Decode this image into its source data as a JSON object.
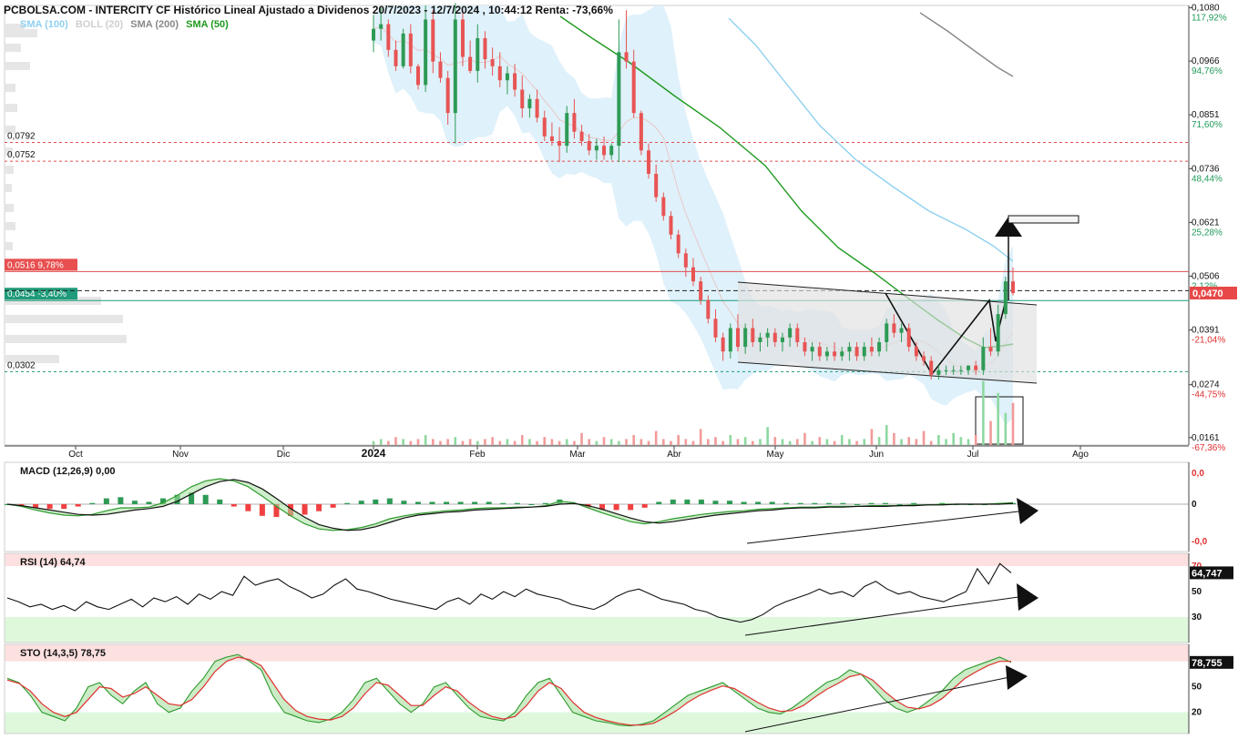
{
  "header": {
    "title": "PCBOLSA.COM - INTERCITY CF Histórico Lineal Ajustado a Dividenos 20/7/2023 - 12/7/2024 , 10:44:12 Renta: -73,66%",
    "legend": [
      {
        "label": "SMA (100)",
        "color": "#8fd0f0"
      },
      {
        "label": "BOLL (20)",
        "color": "#cfcfcf"
      },
      {
        "label": "SMA (200)",
        "color": "#888888"
      },
      {
        "label": "SMA (50)",
        "color": "#1f9a1f"
      }
    ]
  },
  "chart_data": [
    {
      "type": "candlestick",
      "panel": "price",
      "months": [
        "Oct",
        "Nov",
        "Dic",
        "2024",
        "Feb",
        "Mar",
        "Abr",
        "May",
        "Jun",
        "Jul",
        "Ago"
      ],
      "y_ticks": [
        {
          "price": "0,1080",
          "pct": "117,92%"
        },
        {
          "price": "0,0966",
          "pct": "94,76%"
        },
        {
          "price": "0,0851",
          "pct": "71,60%"
        },
        {
          "price": "0,0736",
          "pct": "48,44%"
        },
        {
          "price": "0,0621",
          "pct": "25,28%"
        },
        {
          "price": "0,0506",
          "pct": "2,12%"
        },
        {
          "price": "0,0391",
          "pct": "-21,04%"
        },
        {
          "price": "0,0274",
          "pct": "-44,75%"
        },
        {
          "price": "0,0161",
          "pct": "-67,36%"
        }
      ],
      "ylim": [
        0.0145,
        0.1085
      ],
      "last_price": "0,0470",
      "last_price_value": 0.047,
      "level_labels": [
        {
          "text": "0,0792",
          "value": 0.0792,
          "style": "red-dashed"
        },
        {
          "text": "0,0752",
          "value": 0.0752,
          "style": "red-dashed"
        },
        {
          "text": "0,0516  9,78%",
          "value": 0.0516,
          "style": "red-solid"
        },
        {
          "text": "0,0454  -3,40%",
          "value": 0.0454,
          "style": "green-solid"
        },
        {
          "text": "0,0302",
          "value": 0.0302,
          "style": "green-dashed"
        }
      ],
      "candles": [
        [
          0.101,
          0.1065,
          0.0985,
          0.1035
        ],
        [
          0.1035,
          0.108,
          0.101,
          0.1045
        ],
        [
          0.1045,
          0.1055,
          0.0975,
          0.099
        ],
        [
          0.099,
          0.101,
          0.0945,
          0.0955
        ],
        [
          0.0955,
          0.1035,
          0.095,
          0.1025
        ],
        [
          0.1025,
          0.1045,
          0.094,
          0.0955
        ],
        [
          0.0955,
          0.096,
          0.0905,
          0.0915
        ],
        [
          0.0915,
          0.1085,
          0.09,
          0.1055
        ],
        [
          0.1055,
          0.1075,
          0.094,
          0.0965
        ],
        [
          0.0965,
          0.0985,
          0.092,
          0.093
        ],
        [
          0.093,
          0.0945,
          0.083,
          0.0855
        ],
        [
          0.0855,
          0.109,
          0.079,
          0.1055
        ],
        [
          0.1055,
          0.1075,
          0.0955,
          0.0975
        ],
        [
          0.0975,
          0.101,
          0.094,
          0.0945
        ],
        [
          0.0945,
          0.1045,
          0.092,
          0.1015
        ],
        [
          0.1015,
          0.103,
          0.095,
          0.097
        ],
        [
          0.097,
          0.0995,
          0.0935,
          0.0955
        ],
        [
          0.0955,
          0.0985,
          0.091,
          0.0925
        ],
        [
          0.0925,
          0.0955,
          0.0895,
          0.094
        ],
        [
          0.094,
          0.096,
          0.089,
          0.0905
        ],
        [
          0.0905,
          0.0935,
          0.0845,
          0.0865
        ],
        [
          0.0865,
          0.0895,
          0.0845,
          0.0885
        ],
        [
          0.0885,
          0.0905,
          0.0835,
          0.0845
        ],
        [
          0.0845,
          0.086,
          0.0795,
          0.0805
        ],
        [
          0.0805,
          0.0835,
          0.0785,
          0.0795
        ],
        [
          0.0795,
          0.0825,
          0.075,
          0.0785
        ],
        [
          0.0785,
          0.087,
          0.077,
          0.0855
        ],
        [
          0.0855,
          0.0885,
          0.08,
          0.0815
        ],
        [
          0.0815,
          0.083,
          0.0785,
          0.0795
        ],
        [
          0.0795,
          0.081,
          0.0765,
          0.0775
        ],
        [
          0.0775,
          0.08,
          0.0755,
          0.0785
        ],
        [
          0.0785,
          0.0805,
          0.0755,
          0.0765
        ],
        [
          0.0765,
          0.079,
          0.0755,
          0.0785
        ],
        [
          0.0785,
          0.1055,
          0.075,
          0.0985
        ],
        [
          0.0985,
          0.1075,
          0.095,
          0.0965
        ],
        [
          0.0965,
          0.099,
          0.0845,
          0.0855
        ],
        [
          0.0855,
          0.086,
          0.0765,
          0.0775
        ],
        [
          0.0775,
          0.079,
          0.0715,
          0.0725
        ],
        [
          0.0725,
          0.0745,
          0.0665,
          0.0675
        ],
        [
          0.0675,
          0.0685,
          0.0625,
          0.0635
        ],
        [
          0.0635,
          0.0645,
          0.0585,
          0.0595
        ],
        [
          0.0595,
          0.0605,
          0.0545,
          0.0555
        ],
        [
          0.0555,
          0.0565,
          0.0505,
          0.0525
        ],
        [
          0.0525,
          0.0545,
          0.0485,
          0.0495
        ],
        [
          0.0495,
          0.0505,
          0.0445,
          0.0455
        ],
        [
          0.0455,
          0.0465,
          0.0405,
          0.0415
        ],
        [
          0.0415,
          0.0435,
          0.0365,
          0.0375
        ],
        [
          0.0375,
          0.0385,
          0.0325,
          0.0345
        ],
        [
          0.0345,
          0.0405,
          0.033,
          0.0395
        ],
        [
          0.0395,
          0.0425,
          0.0345,
          0.0355
        ],
        [
          0.0355,
          0.0405,
          0.034,
          0.0395
        ],
        [
          0.0395,
          0.0415,
          0.0355,
          0.0365
        ],
        [
          0.0365,
          0.0385,
          0.0345,
          0.0375
        ],
        [
          0.0375,
          0.0395,
          0.0355,
          0.0385
        ],
        [
          0.0385,
          0.0395,
          0.0355,
          0.0365
        ],
        [
          0.0365,
          0.0385,
          0.0345,
          0.0375
        ],
        [
          0.0375,
          0.0405,
          0.0355,
          0.0395
        ],
        [
          0.0395,
          0.0405,
          0.0355,
          0.0365
        ],
        [
          0.0365,
          0.0375,
          0.0335,
          0.0345
        ],
        [
          0.0345,
          0.0365,
          0.0325,
          0.0355
        ],
        [
          0.0355,
          0.0365,
          0.0325,
          0.0335
        ],
        [
          0.0335,
          0.0355,
          0.0325,
          0.0345
        ],
        [
          0.0345,
          0.0365,
          0.0325,
          0.0335
        ],
        [
          0.0335,
          0.0355,
          0.0325,
          0.0345
        ],
        [
          0.0345,
          0.0365,
          0.0325,
          0.0355
        ],
        [
          0.0355,
          0.0365,
          0.0325,
          0.0335
        ],
        [
          0.0335,
          0.0365,
          0.0325,
          0.0355
        ],
        [
          0.0355,
          0.0375,
          0.0335,
          0.0345
        ],
        [
          0.0345,
          0.0375,
          0.0335,
          0.0365
        ],
        [
          0.0365,
          0.0415,
          0.0345,
          0.0405
        ],
        [
          0.0405,
          0.0425,
          0.0375,
          0.0385
        ],
        [
          0.0385,
          0.0405,
          0.0365,
          0.0395
        ],
        [
          0.0395,
          0.0405,
          0.0345,
          0.0355
        ],
        [
          0.0355,
          0.0365,
          0.0325,
          0.0335
        ],
        [
          0.0335,
          0.0345,
          0.0315,
          0.0325
        ],
        [
          0.0325,
          0.0335,
          0.0285,
          0.0295
        ],
        [
          0.0295,
          0.0315,
          0.0285,
          0.0305
        ],
        [
          0.0305,
          0.0315,
          0.0295,
          0.0305
        ],
        [
          0.0305,
          0.0315,
          0.0295,
          0.0305
        ],
        [
          0.0305,
          0.0315,
          0.0295,
          0.0305
        ],
        [
          0.0305,
          0.0315,
          0.0295,
          0.0315
        ],
        [
          0.0315,
          0.0325,
          0.0295,
          0.0305
        ],
        [
          0.0305,
          0.0375,
          0.0295,
          0.0355
        ],
        [
          0.0355,
          0.0395,
          0.0335,
          0.0345
        ],
        [
          0.0345,
          0.0445,
          0.0335,
          0.0425
        ],
        [
          0.0425,
          0.0505,
          0.0415,
          0.0495
        ],
        [
          0.0495,
          0.0525,
          0.0465,
          0.047
        ]
      ],
      "volume": [
        0.2,
        0.3,
        0.2,
        0.4,
        0.3,
        0.2,
        0.3,
        0.5,
        0.3,
        0.2,
        0.3,
        0.4,
        0.2,
        0.3,
        0.2,
        0.3,
        0.4,
        0.2,
        0.3,
        0.2,
        0.5,
        0.3,
        0.2,
        0.4,
        0.3,
        0.2,
        0.3,
        0.2,
        0.6,
        0.3,
        0.2,
        0.4,
        0.3,
        0.2,
        0.3,
        0.5,
        0.3,
        0.2,
        0.7,
        0.3,
        0.2,
        0.5,
        0.3,
        0.2,
        0.8,
        0.3,
        0.4,
        0.2,
        0.5,
        0.3,
        0.4,
        0.2,
        0.3,
        0.9,
        0.4,
        0.3,
        0.2,
        0.3,
        0.6,
        0.2,
        0.4,
        0.3,
        0.2,
        0.5,
        0.3,
        0.2,
        0.3,
        0.8,
        0.4,
        1.0,
        0.6,
        0.3,
        0.4,
        0.3,
        0.7,
        0.2,
        0.5,
        0.3,
        0.6,
        0.4,
        0.3,
        0.5,
        3.2,
        1.2,
        2.6,
        1.6,
        2.1
      ]
    },
    {
      "type": "histogram+line",
      "panel": "macd",
      "label": "MACD (12,26,9)",
      "value": "0,00",
      "y_ticks": [
        "0,0",
        "0",
        "-0,0"
      ],
      "macd": [
        0.0,
        -0.3,
        -0.8,
        -1.2,
        -1.5,
        -1.6,
        -1.4,
        -0.9,
        -0.5,
        -0.5,
        -0.4,
        0.2,
        1.2,
        2.4,
        3.2,
        3.5,
        3.2,
        2.4,
        1.1,
        -0.3,
        -1.6,
        -2.7,
        -3.4,
        -3.6,
        -3.5,
        -3.2,
        -2.7,
        -2.0,
        -1.6,
        -1.3,
        -1.1,
        -0.9,
        -0.8,
        -0.6,
        -0.5,
        -0.5,
        -0.4,
        -0.4,
        -0.2,
        0.4,
        0.2,
        -0.5,
        -1.2,
        -1.8,
        -2.4,
        -2.7,
        -2.4,
        -2.0,
        -1.7,
        -1.4,
        -1.2,
        -1.0,
        -0.9,
        -0.7,
        -0.6,
        -0.5,
        -0.4,
        -0.4,
        -0.3,
        -0.3,
        -0.3,
        -0.2,
        -0.2,
        -0.2,
        -0.1,
        -0.1,
        0.0,
        0.0,
        0.0,
        0.0,
        0.1,
        0.2
      ],
      "signal": [
        0.0,
        -0.2,
        -0.5,
        -0.8,
        -1.1,
        -1.4,
        -1.5,
        -1.4,
        -1.1,
        -0.8,
        -0.6,
        -0.3,
        0.4,
        1.4,
        2.4,
        3.1,
        3.4,
        3.0,
        2.1,
        0.8,
        -0.6,
        -1.8,
        -2.8,
        -3.3,
        -3.6,
        -3.5,
        -3.1,
        -2.5,
        -1.9,
        -1.5,
        -1.3,
        -1.1,
        -1.0,
        -0.8,
        -0.7,
        -0.6,
        -0.5,
        -0.4,
        -0.3,
        0.0,
        0.1,
        -0.2,
        -0.7,
        -1.3,
        -1.9,
        -2.4,
        -2.6,
        -2.4,
        -2.1,
        -1.8,
        -1.5,
        -1.3,
        -1.1,
        -0.9,
        -0.8,
        -0.6,
        -0.5,
        -0.5,
        -0.4,
        -0.4,
        -0.3,
        -0.3,
        -0.3,
        -0.2,
        -0.2,
        -0.1,
        -0.1,
        0.0,
        0.0,
        0.0,
        0.0,
        0.1
      ]
    },
    {
      "type": "line",
      "panel": "rsi",
      "label": "RSI (14)",
      "value": "64,74",
      "last_value": "64,747",
      "y_ticks": [
        "70",
        "50",
        "30"
      ],
      "values": [
        45,
        42,
        38,
        40,
        36,
        39,
        35,
        42,
        38,
        36,
        40,
        44,
        38,
        45,
        42,
        46,
        40,
        48,
        44,
        50,
        47,
        62,
        55,
        58,
        60,
        54,
        50,
        45,
        48,
        55,
        60,
        52,
        50,
        47,
        44,
        42,
        40,
        38,
        36,
        42,
        45,
        40,
        48,
        44,
        50,
        46,
        52,
        48,
        46,
        44,
        40,
        38,
        36,
        40,
        46,
        50,
        52,
        48,
        44,
        42,
        40,
        36,
        34,
        30,
        28,
        26,
        28,
        32,
        38,
        42,
        45,
        48,
        52,
        48,
        50,
        46,
        54,
        58,
        52,
        48,
        50,
        46,
        44,
        42,
        46,
        50,
        68,
        56,
        72,
        64.7
      ]
    },
    {
      "type": "line",
      "panel": "sto",
      "label": "STO (14,3,5)",
      "value": "78,75",
      "last_value": "78,755",
      "y_ticks": [
        "50",
        "20"
      ],
      "k": [
        60,
        55,
        40,
        20,
        15,
        10,
        25,
        50,
        55,
        40,
        30,
        45,
        55,
        30,
        20,
        25,
        45,
        60,
        80,
        85,
        88,
        80,
        70,
        40,
        20,
        15,
        10,
        8,
        12,
        20,
        35,
        55,
        60,
        45,
        30,
        20,
        30,
        50,
        55,
        40,
        25,
        15,
        12,
        10,
        20,
        40,
        55,
        60,
        40,
        20,
        15,
        10,
        8,
        5,
        4,
        6,
        10,
        20,
        30,
        40,
        45,
        50,
        55,
        45,
        35,
        25,
        20,
        18,
        25,
        35,
        45,
        55,
        60,
        70,
        65,
        50,
        35,
        25,
        20,
        25,
        35,
        45,
        60,
        70,
        75,
        80,
        85,
        78.75
      ],
      "d": [
        58,
        54,
        45,
        30,
        20,
        15,
        20,
        35,
        50,
        48,
        38,
        42,
        50,
        40,
        30,
        28,
        35,
        50,
        68,
        80,
        85,
        82,
        75,
        55,
        35,
        22,
        15,
        12,
        11,
        15,
        25,
        42,
        55,
        52,
        40,
        28,
        28,
        40,
        50,
        45,
        32,
        22,
        15,
        12,
        15,
        28,
        45,
        55,
        48,
        32,
        20,
        14,
        10,
        7,
        5,
        5,
        7,
        14,
        22,
        32,
        40,
        46,
        51,
        48,
        40,
        32,
        25,
        21,
        22,
        28,
        38,
        47,
        54,
        62,
        65,
        58,
        45,
        34,
        26,
        24,
        28,
        36,
        48,
        60,
        68,
        75,
        80,
        80
      ]
    }
  ]
}
